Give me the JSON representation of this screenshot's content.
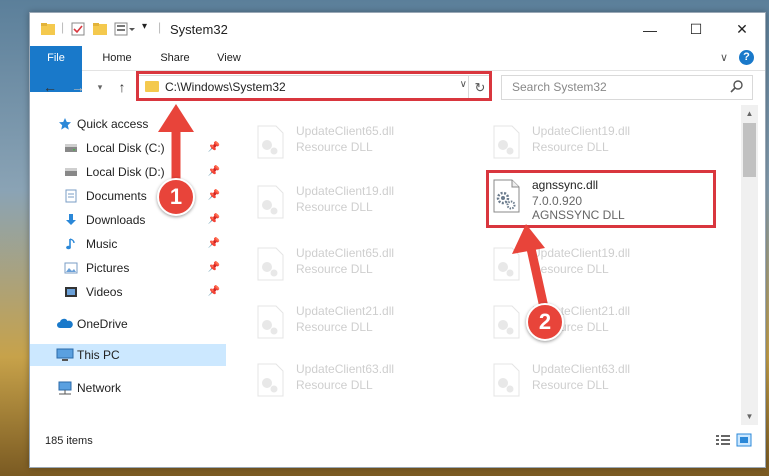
{
  "window": {
    "title": "System32",
    "minimize": "—",
    "maximize": "☐",
    "close": "✕"
  },
  "ribbon": {
    "tabs": [
      "File",
      "Home",
      "Share",
      "View"
    ],
    "collapse": "∨",
    "help": "?"
  },
  "nav": {
    "address": "C:\\Windows\\System32",
    "search_placeholder": "Search System32"
  },
  "sidebar": {
    "items": [
      {
        "label": "Quick access",
        "icon": "star-icon"
      },
      {
        "label": "Local Disk (C:)",
        "icon": "drive-icon",
        "pinned": true
      },
      {
        "label": "Local Disk (D:)",
        "icon": "drive-icon",
        "pinned": true
      },
      {
        "label": "Documents",
        "icon": "documents-icon",
        "pinned": true
      },
      {
        "label": "Downloads",
        "icon": "downloads-icon",
        "pinned": true
      },
      {
        "label": "Music",
        "icon": "music-icon",
        "pinned": true
      },
      {
        "label": "Pictures",
        "icon": "pictures-icon",
        "pinned": true
      },
      {
        "label": "Videos",
        "icon": "videos-icon",
        "pinned": true
      },
      {
        "label": "OneDrive",
        "icon": "onedrive-icon"
      },
      {
        "label": "This PC",
        "icon": "pc-icon",
        "selected": true
      },
      {
        "label": "Network",
        "icon": "network-icon"
      }
    ]
  },
  "files": [
    {
      "name": "UpdateClient65.dll",
      "type": "Resource DLL"
    },
    {
      "name": "UpdateClient19.dll",
      "type": "Resource DLL"
    },
    {
      "name": "UpdateClient19.dll",
      "type": "Resource DLL"
    },
    {
      "name": "agnssync.dll",
      "version": "7.0.0.920",
      "type": "AGNSSYNC DLL",
      "highlighted": true
    },
    {
      "name": "UpdateClient65.dll",
      "type": "Resource DLL"
    },
    {
      "name": "UpdateClient19.dll",
      "type": "Resource DLL"
    },
    {
      "name": "UpdateClient21.dll",
      "type": "Resource DLL"
    },
    {
      "name": "UpdateClient21.dll",
      "type": "Resource DLL"
    },
    {
      "name": "UpdateClient63.dll",
      "type": "Resource DLL"
    },
    {
      "name": "UpdateClient63.dll",
      "type": "Resource DLL"
    }
  ],
  "status": {
    "items": "185 items"
  },
  "annotations": {
    "badge1": "1",
    "badge2": "2"
  },
  "colors": {
    "accent": "#1979ca",
    "highlight": "#d9363e",
    "badge": "#e8443a",
    "selected": "#cce8ff"
  }
}
